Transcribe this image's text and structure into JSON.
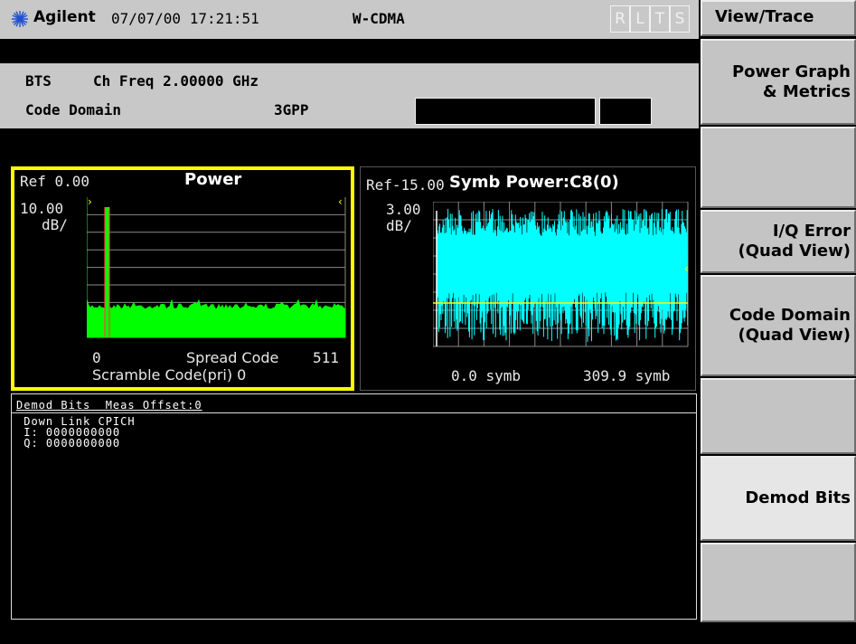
{
  "status_bar": {
    "brand": "Agilent",
    "datetime": "07/07/00 17:21:51",
    "mode": "W-CDMA",
    "indicators": [
      "R",
      "L",
      "T",
      "S"
    ]
  },
  "info": {
    "device": "BTS",
    "ch_freq": "Ch Freq 2.00000 GHz",
    "measurement": "Code Domain",
    "standard": "3GPP"
  },
  "power_panel": {
    "ref": "Ref 0.00",
    "title": "Power",
    "scale_value": "10.00",
    "scale_unit": "dB/",
    "x_start": "0",
    "x_label": "Spread Code",
    "x_end": "511",
    "scramble": "Scramble Code(pri) 0"
  },
  "symb_panel": {
    "ref": "Ref-15.00",
    "title": "Symb Power:C8(0)",
    "scale_value": "3.00",
    "scale_unit": "dB/",
    "x_start": "0.0 symb",
    "x_end": "309.9 symb"
  },
  "demod": {
    "header": "Demod Bits  Meas Offset:0",
    "channel": " Down Link CPICH",
    "i_bits": " I: 0000000000",
    "q_bits": " Q: 0000000000"
  },
  "softkeys": {
    "title": "View/Trace",
    "power_graph": [
      "Power Graph",
      "& Metrics"
    ],
    "iq_error": [
      "I/Q Error",
      "(Quad View)"
    ],
    "code_domain": [
      "Code Domain",
      "(Quad View)"
    ],
    "demod_bits": "Demod Bits"
  },
  "colors": {
    "power_trace": "#00ff00",
    "symb_trace": "#00ffff",
    "highlight": "#ffff00",
    "marker_bar": "#ff4040"
  }
}
